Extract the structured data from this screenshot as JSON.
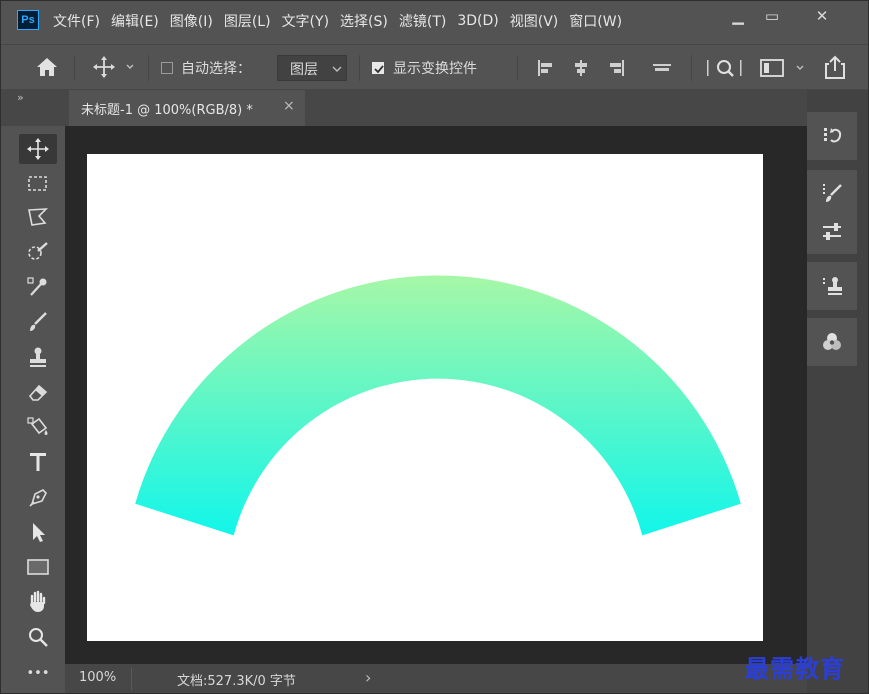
{
  "app": {
    "logo": "Ps"
  },
  "menu": [
    "文件(F)",
    "编辑(E)",
    "图像(I)",
    "图层(L)",
    "文字(Y)",
    "选择(S)",
    "滤镜(T)",
    "3D(D)",
    "视图(V)",
    "窗口(W)"
  ],
  "window_controls": {
    "minimize": "▁",
    "maximize": "▭",
    "close": "✕"
  },
  "options": {
    "auto_select_label": "自动选择：",
    "auto_select_checked": false,
    "layer_dropdown": "图层",
    "show_transform_label": "显示变换控件",
    "show_transform_checked": true
  },
  "tab": {
    "title": "未标题-1 @ 100%(RGB/8) *",
    "close": "×"
  },
  "panels": {
    "collapse_left": "»",
    "collapse_right": "«"
  },
  "toolbar": {
    "more": "•••"
  },
  "status": {
    "zoom": "100%",
    "doc_info": "文档:527.3K/0 字节",
    "arrow": "›"
  },
  "watermark": "最需教育",
  "colors": {
    "gradient_top": "#a6f7a6",
    "gradient_bottom": "#12f6ea",
    "canvas_bg": "#282828"
  },
  "icons": [
    "home-icon",
    "move-icon",
    "search-icon",
    "workspace-icon",
    "share-icon",
    "history-icon",
    "brush-settings-icon",
    "adjustments-icon",
    "clone-source-icon",
    "3d-material-icon"
  ]
}
